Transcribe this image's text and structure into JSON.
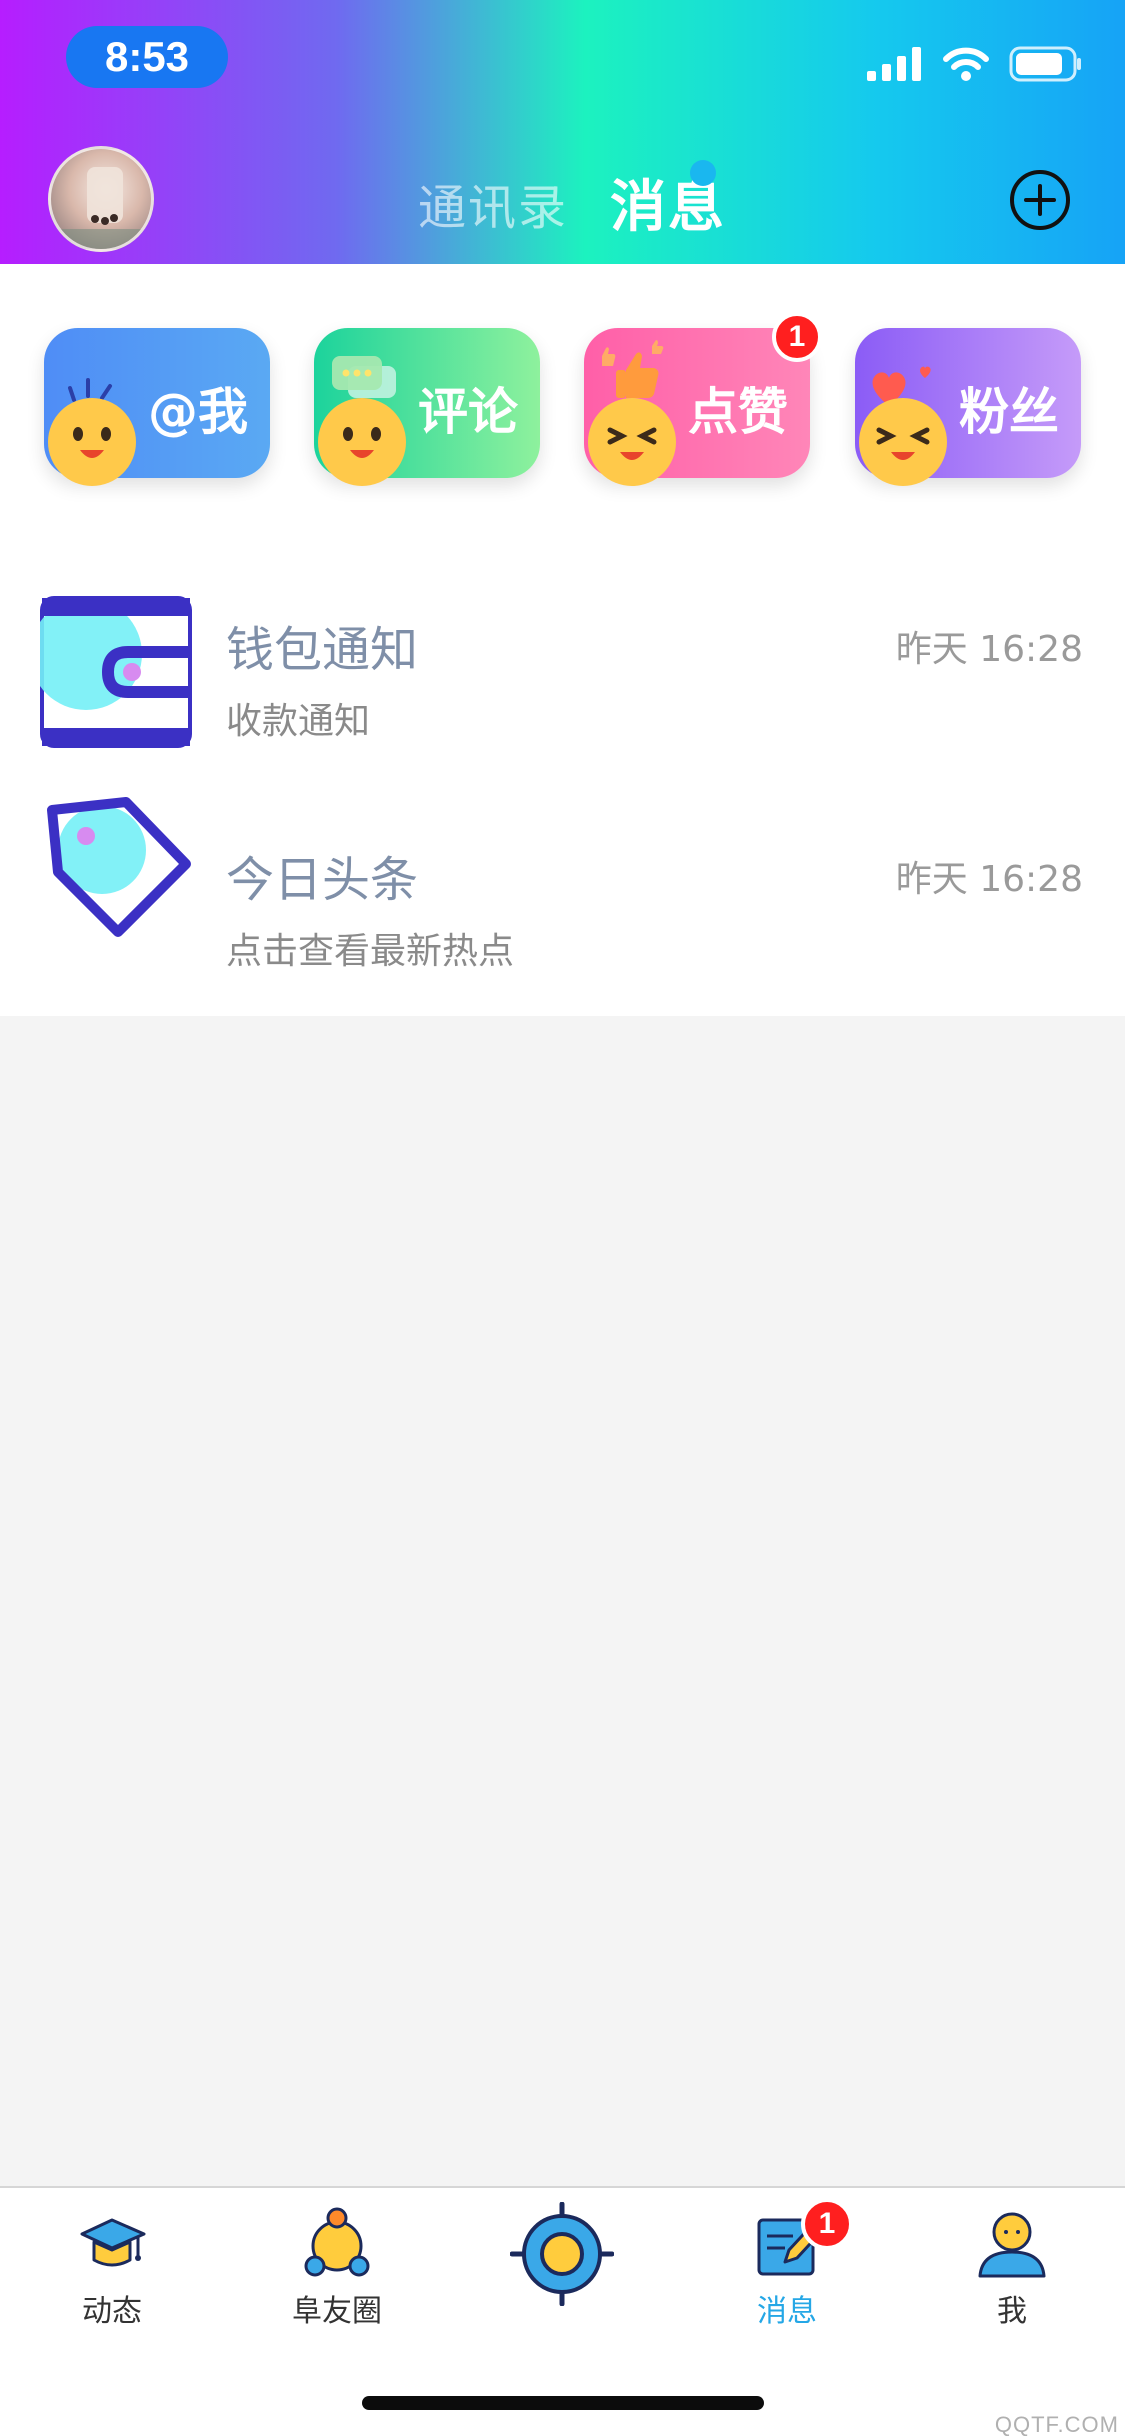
{
  "status_bar": {
    "time": "8:53"
  },
  "header": {
    "tabs": [
      {
        "label": "通讯录",
        "active": false
      },
      {
        "label": "消息",
        "active": true
      }
    ]
  },
  "categories": [
    {
      "label": "@我",
      "colors": [
        "#4f8df6",
        "#5aa9f3"
      ]
    },
    {
      "label": "评论",
      "colors": [
        "#1cd39c",
        "#8ef19d"
      ]
    },
    {
      "label": "点赞",
      "colors": [
        "#ff5fa8",
        "#ff86b8"
      ],
      "badge": "1"
    },
    {
      "label": "粉丝",
      "colors": [
        "#8b5cf6",
        "#c59bf9"
      ]
    }
  ],
  "messages": [
    {
      "title": "钱包通知",
      "subtitle": "收款通知",
      "time": "昨天 16:28",
      "icon": "wallet-icon"
    },
    {
      "title": "今日头条",
      "subtitle": "点击查看最新热点",
      "time": "昨天 16:28",
      "icon": "tag-icon"
    }
  ],
  "bottom_nav": [
    {
      "label": "动态",
      "icon": "graduation-cap-icon"
    },
    {
      "label": "阜友圈",
      "icon": "group-icon"
    },
    {
      "label": "",
      "icon": "target-icon"
    },
    {
      "label": "消息",
      "icon": "message-edit-icon",
      "active": true,
      "badge": "1"
    },
    {
      "label": "我",
      "icon": "user-icon"
    }
  ],
  "watermark": "QQTF.COM"
}
